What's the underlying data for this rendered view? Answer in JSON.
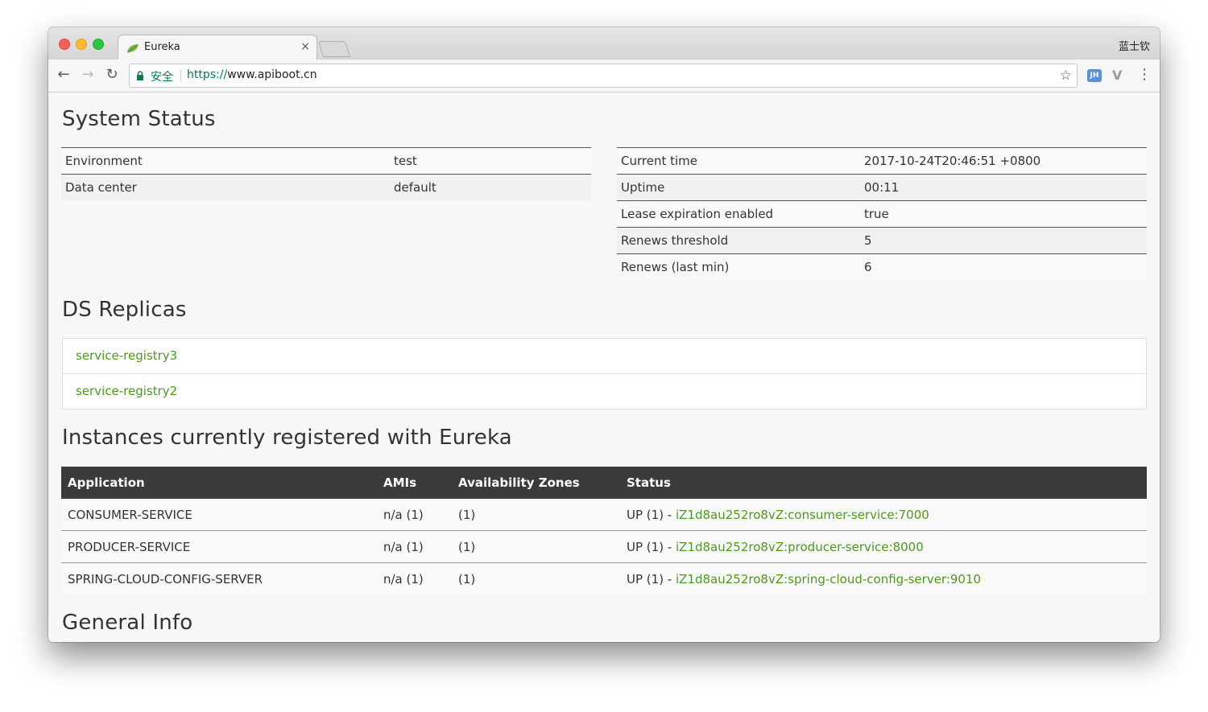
{
  "browser": {
    "tab_title": "Eureka",
    "tab_close": "×",
    "profile_name": "蓝士钦",
    "secure_label": "安全",
    "url_scheme": "https://",
    "url_host": "www.apiboot.cn",
    "extension_jh": "JH",
    "extension_v": "V"
  },
  "system_status": {
    "title": "System Status",
    "left_rows": [
      {
        "label": "Environment",
        "value": "test"
      },
      {
        "label": "Data center",
        "value": "default"
      }
    ],
    "right_rows": [
      {
        "label": "Current time",
        "value": "2017-10-24T20:46:51 +0800"
      },
      {
        "label": "Uptime",
        "value": "00:11"
      },
      {
        "label": "Lease expiration enabled",
        "value": "true"
      },
      {
        "label": "Renews threshold",
        "value": "5"
      },
      {
        "label": "Renews (last min)",
        "value": "6"
      }
    ]
  },
  "ds_replicas": {
    "title": "DS Replicas",
    "items": [
      "service-registry3",
      "service-registry2"
    ]
  },
  "instances": {
    "title": "Instances currently registered with Eureka",
    "headers": [
      "Application",
      "AMIs",
      "Availability Zones",
      "Status"
    ],
    "rows": [
      {
        "application": "CONSUMER-SERVICE",
        "amis": "n/a (1)",
        "zones": "(1)",
        "status_prefix": "UP (1) - ",
        "status_link": "iZ1d8au252ro8vZ:consumer-service:7000"
      },
      {
        "application": "PRODUCER-SERVICE",
        "amis": "n/a (1)",
        "zones": "(1)",
        "status_prefix": "UP (1) - ",
        "status_link": "iZ1d8au252ro8vZ:producer-service:8000"
      },
      {
        "application": "SPRING-CLOUD-CONFIG-SERVER",
        "amis": "n/a (1)",
        "zones": "(1)",
        "status_prefix": "UP (1) - ",
        "status_link": "iZ1d8au252ro8vZ:spring-cloud-config-server:9010"
      }
    ]
  },
  "general_info": {
    "title": "General Info"
  },
  "colors": {
    "link_green": "#4e9a1e",
    "header_dark": "#3b3b3b",
    "secure_green": "#0b8043"
  }
}
